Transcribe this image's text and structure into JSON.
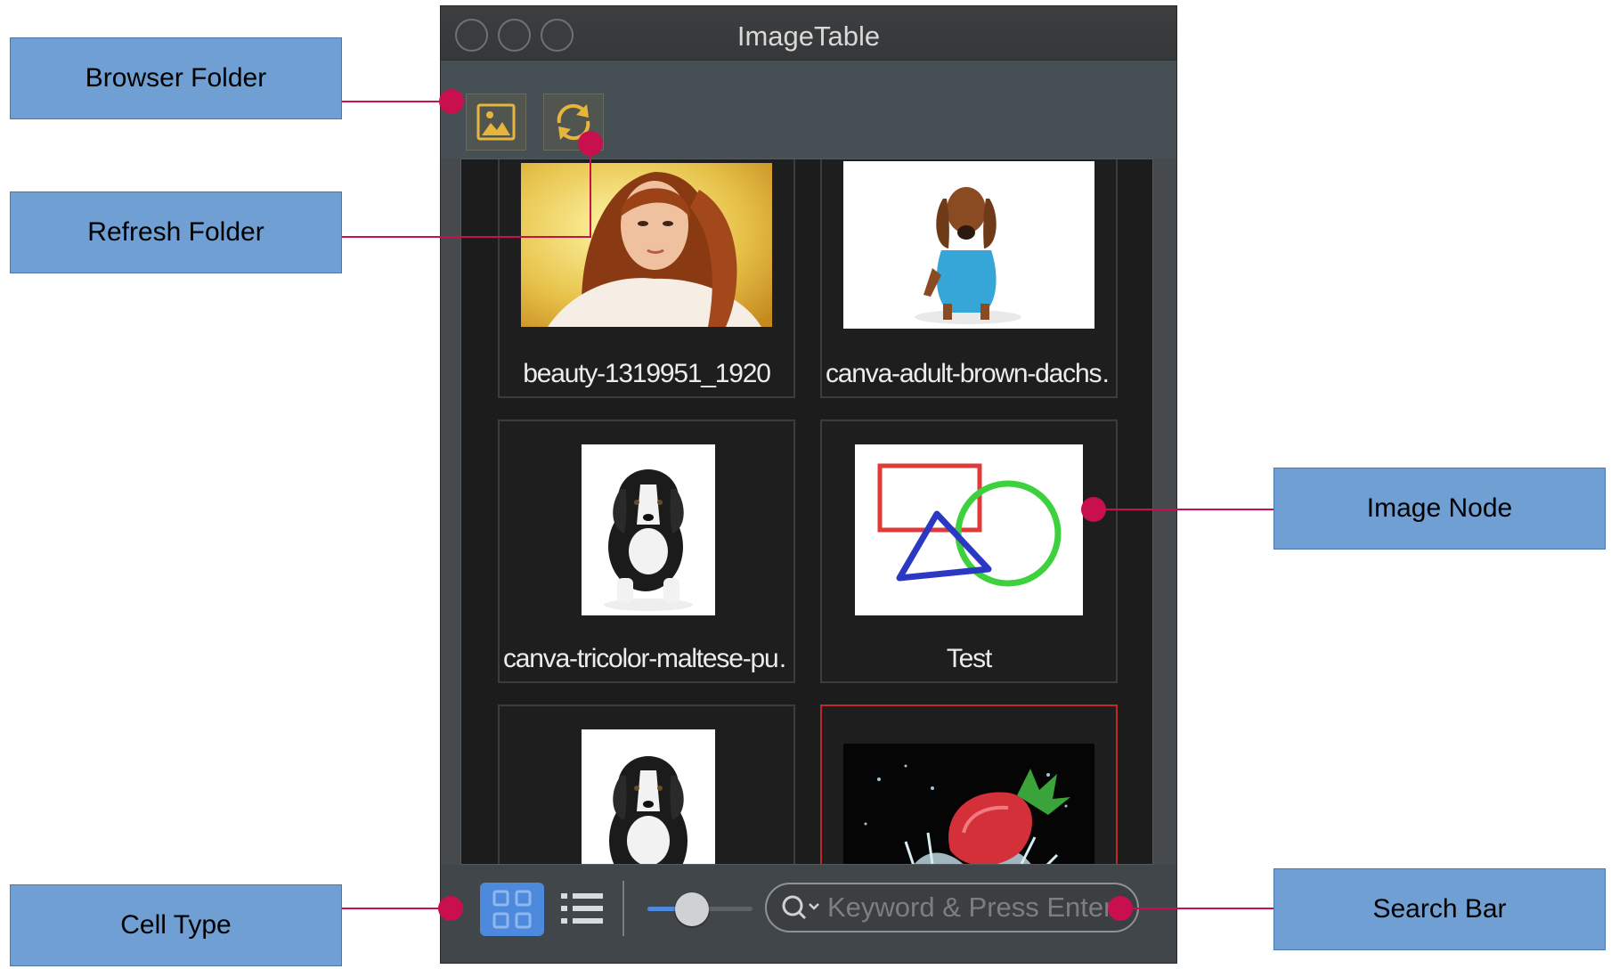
{
  "window": {
    "title": "ImageTable"
  },
  "callouts": {
    "browser_folder": "Browser Folder",
    "refresh_folder": "Refresh Folder",
    "image_node": "Image Node",
    "cell_type": "Cell Type",
    "search_bar": "Search Bar"
  },
  "images": [
    {
      "caption": "beauty-1319951_1920",
      "subject": "portrait of woman with long auburn hair"
    },
    {
      "caption": "canva-adult-brown-dachs…",
      "subject": "brown dachshund in blue sweater"
    },
    {
      "caption": "canva-tricolor-maltese-pu…",
      "subject": "tricolor puppy sitting"
    },
    {
      "caption": "Test",
      "subject": "red rectangle, blue triangle, green circle"
    },
    {
      "caption": "",
      "subject": "tricolor puppy"
    },
    {
      "caption": "",
      "subject": "strawberry splashing in water"
    }
  ],
  "bottombar": {
    "search_placeholder": "Keyword & Press Enter",
    "thumbnail_size_fraction": 0.42,
    "active_cell_type": "grid"
  },
  "colors": {
    "callout_fill": "#6f9fd3",
    "leader_line": "#c8104f",
    "accent": "#4d89dc",
    "selection": "#c0282e",
    "toolbar_icon": "#e7b53c"
  },
  "icons": [
    "image-folder-icon",
    "refresh-icon",
    "grid-view-icon",
    "list-view-icon",
    "search-icon"
  ]
}
